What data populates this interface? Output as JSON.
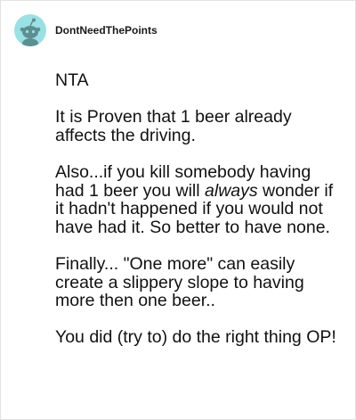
{
  "comment": {
    "username": "DontNeedThePoints",
    "avatar_icon": "reddit-snoo-avatar-icon",
    "paragraphs": {
      "p1": "NTA",
      "p2": "It is Proven that 1 beer already affects the driving.",
      "p3_before": "Also...if you kill somebody having had 1 beer you will ",
      "p3_emphasis": "always",
      "p3_after": " wonder if it hadn't happened if you would not have had it. So better to have none.",
      "p4": "Finally... \"One more\" can easily create a slippery slope to having more then one beer..",
      "p5": "You did (try to) do the right thing OP!"
    }
  },
  "colors": {
    "avatar_bg": "#9be0e3",
    "text": "#111111",
    "border": "#e2e2e2"
  }
}
